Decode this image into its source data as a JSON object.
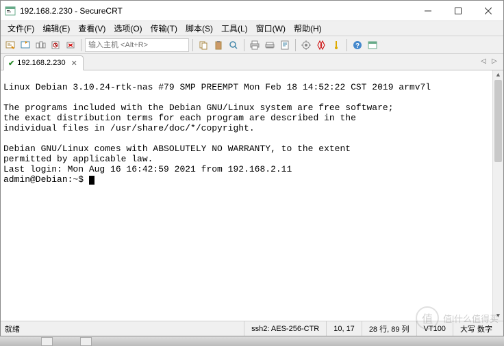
{
  "window": {
    "title": "192.168.2.230 - SecureCRT"
  },
  "menu": {
    "file": "文件(F)",
    "edit": "编辑(E)",
    "view": "查看(V)",
    "options": "选项(O)",
    "transfer": "传输(T)",
    "script": "脚本(S)",
    "tools": "工具(L)",
    "window": "窗口(W)",
    "help": "帮助(H)"
  },
  "toolbar": {
    "host_placeholder": "输入主机 <Alt+R>"
  },
  "tab": {
    "label": "192.168.2.230"
  },
  "terminal": {
    "line1": "Linux Debian 3.10.24-rtk-nas #79 SMP PREEMPT Mon Feb 18 14:52:22 CST 2019 armv7l",
    "line2": "",
    "line3": "The programs included with the Debian GNU/Linux system are free software;",
    "line4": "the exact distribution terms for each program are described in the",
    "line5": "individual files in /usr/share/doc/*/copyright.",
    "line6": "",
    "line7": "Debian GNU/Linux comes with ABSOLUTELY NO WARRANTY, to the extent",
    "line8": "permitted by applicable law.",
    "line9": "Last login: Mon Aug 16 16:42:59 2021 from 192.168.2.11",
    "prompt": "admin@Debian:~$ "
  },
  "status": {
    "ready": "就绪",
    "protocol": "ssh2: AES-256-CTR",
    "cursor": "10,  17",
    "size": "28 行, 89 列",
    "term": "VT100",
    "caps": "大写 数字"
  },
  "watermark": {
    "text": "值l什么值得买"
  }
}
